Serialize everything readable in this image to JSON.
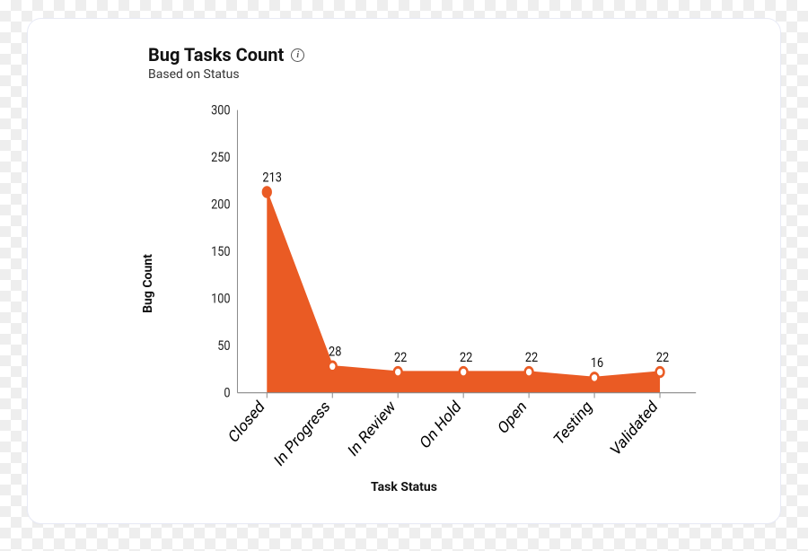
{
  "header": {
    "title": "Bug Tasks Count",
    "subtitle": "Based on Status",
    "info_tooltip": "i"
  },
  "chart_data": {
    "type": "area",
    "title": "Bug Tasks Count",
    "categories": [
      "Closed",
      "In Progress",
      "In Review",
      "On Hold",
      "Open",
      "Testing",
      "Validated"
    ],
    "values": [
      213,
      28,
      22,
      22,
      22,
      16,
      22
    ],
    "xlabel": "Task Status",
    "ylabel": "Bug Count",
    "ylim": [
      0,
      300
    ],
    "yticks": [
      0,
      50,
      100,
      150,
      200,
      250,
      300
    ],
    "series_color": "#ea5b24"
  }
}
